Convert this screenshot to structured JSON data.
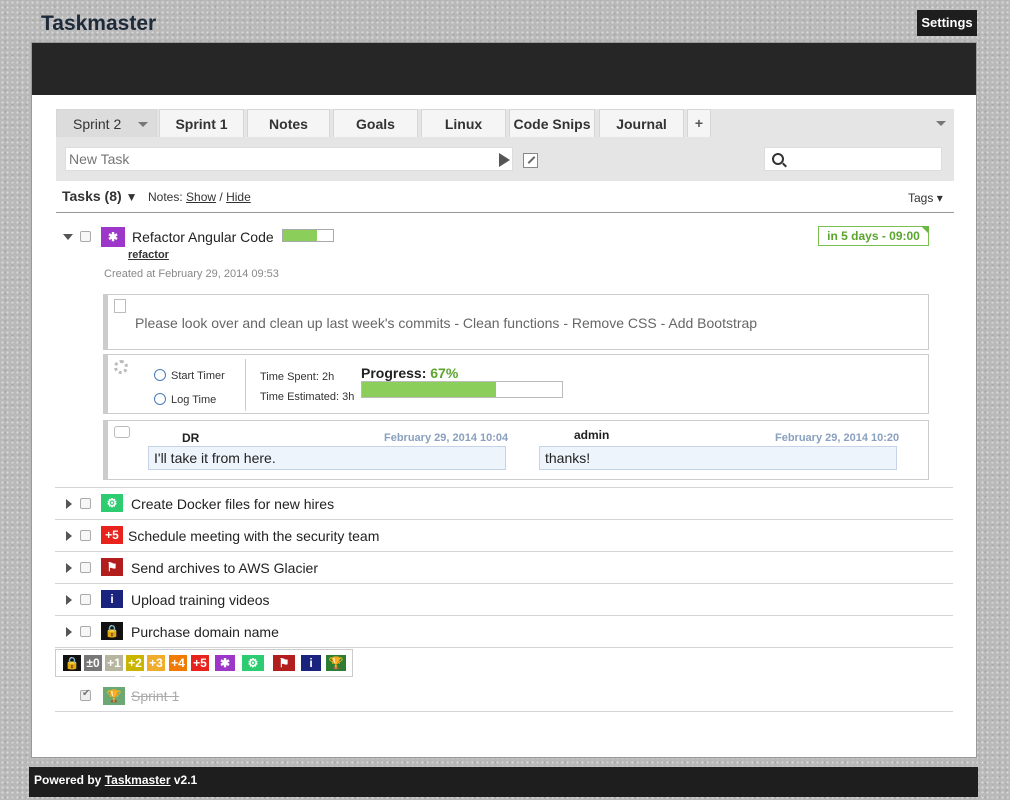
{
  "app": {
    "title": "Taskmaster",
    "settings_label": "Settings"
  },
  "tabs": [
    {
      "label": "Sprint 2"
    },
    {
      "label": "Sprint 1"
    },
    {
      "label": "Notes"
    },
    {
      "label": "Goals"
    },
    {
      "label": "Linux"
    },
    {
      "label": "Code Snips"
    },
    {
      "label": "Journal"
    }
  ],
  "add_tab_label": "+",
  "new_task": {
    "placeholder": "New Task"
  },
  "tasks_header": {
    "label": "Tasks (8)",
    "caret": "▼",
    "notes_label": "Notes:",
    "show": "Show",
    "sep": "/",
    "hide": "Hide",
    "tags": "Tags"
  },
  "expanded_task": {
    "title": "Refactor Angular Code",
    "tag": "refactor",
    "created": "Created at February 29, 2014 09:53",
    "due": "in 5 days - 09:00",
    "note": "Please look over and clean up last week's commits - Clean functions - Remove CSS - Add Bootstrap",
    "start_timer": "Start Timer",
    "log_time": "Log Time",
    "time_spent": "Time Spent: 2h",
    "time_estimated": "Time Estimated: 3h",
    "progress_label": "Progress:",
    "progress_value": "67%",
    "progress_fraction": 0.67,
    "comments": [
      {
        "author": "DR",
        "time": "February 29, 2014 10:04",
        "text": "I'll take it from here."
      },
      {
        "author": "admin",
        "time": "February 29, 2014 10:20",
        "text": "thanks!"
      }
    ]
  },
  "tasks": [
    {
      "title": "Create Docker files for new hires",
      "icon": "gear-icon",
      "color": "#2ecc71",
      "badge": "⚙"
    },
    {
      "title": "Schedule meeting with the security team",
      "icon": "priority-plus5-icon",
      "color": "#e8221c",
      "badge": "+5"
    },
    {
      "title": "Send archives to AWS Glacier",
      "icon": "flag-icon",
      "color": "#b21e1e",
      "badge": "⚑"
    },
    {
      "title": "Upload training videos",
      "icon": "info-icon",
      "color": "#1a237e",
      "badge": "i"
    },
    {
      "title": "Purchase domain name",
      "icon": "lock-icon",
      "color": "#111111",
      "badge": "🔒"
    }
  ],
  "palette": [
    {
      "label": "🔒",
      "color": "#111111"
    },
    {
      "label": "±0",
      "color": "#777777"
    },
    {
      "label": "+1",
      "color": "#b5b5a0"
    },
    {
      "label": "+2",
      "color": "#c9b400"
    },
    {
      "label": "+3",
      "color": "#f0ac2c"
    },
    {
      "label": "+4",
      "color": "#f07b00"
    },
    {
      "label": "+5",
      "color": "#e8221c"
    },
    {
      "label": "✱",
      "color": "#9c37c9"
    },
    {
      "label": "⚙",
      "color": "#2ecc71"
    },
    {
      "label": "⚑",
      "color": "#b21e1e"
    },
    {
      "label": "i",
      "color": "#1a237e"
    },
    {
      "label": "🏆",
      "color": "#2e7d32"
    }
  ],
  "completed_task": {
    "title": "Sprint 1",
    "badge": "🏆"
  },
  "footer": {
    "powered_by": "Powered by",
    "brand": "Taskmaster",
    "version": "v2.1"
  }
}
